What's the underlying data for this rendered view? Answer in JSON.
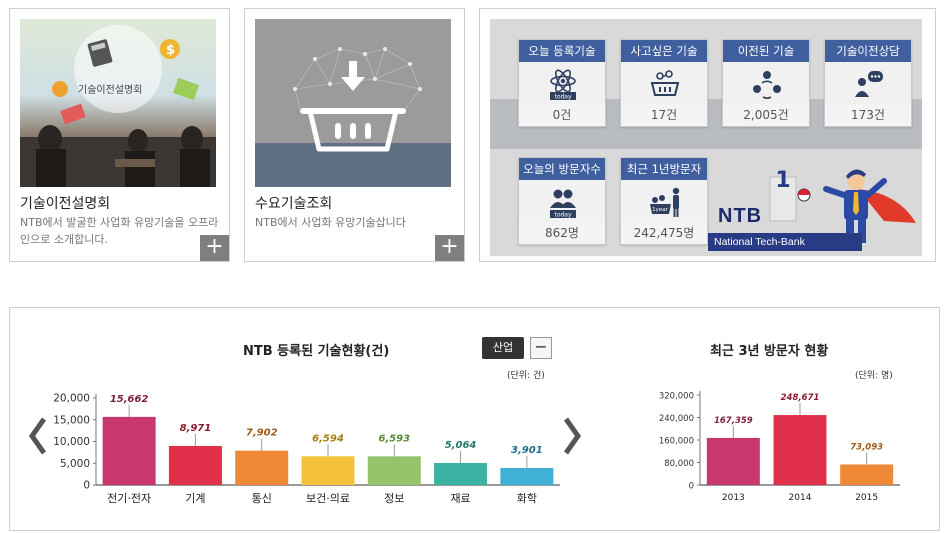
{
  "cards": [
    {
      "title": "기술이전설명회",
      "desc": "NTB에서 발굴한 사업화 유망기술을 오프라인으로 소개합니다.",
      "image_caption": "기술이전설명회",
      "more": "+"
    },
    {
      "title": "수요기술조회",
      "desc": "NTB에서 사업화 유망기술삽니다",
      "more": "+"
    }
  ],
  "stats": {
    "items": [
      {
        "label": "오늘 등록기술",
        "value": "0건",
        "icon": "atom-today-icon",
        "icon_text": "today"
      },
      {
        "label": "사고싶은 기술",
        "value": "17건",
        "icon": "cart-icon"
      },
      {
        "label": "이전된 기술",
        "value": "2,005건",
        "icon": "people-group-icon"
      },
      {
        "label": "기술이전상담",
        "value": "173건",
        "icon": "consult-icon"
      },
      {
        "label": "오늘의 방문자수",
        "value": "862명",
        "icon": "visitors-today-icon",
        "icon_text": "today"
      },
      {
        "label": "최근 1년방문자",
        "value": "242,475명",
        "icon": "year-visitors-icon",
        "icon_text": "1year"
      }
    ],
    "brand": {
      "logo": "NTB",
      "name": "National Tech-Bank"
    }
  },
  "chart1_ui": {
    "title": "NTB 등록된 기술현황(건)",
    "filter_label": "산업",
    "collapse_label": "−",
    "unit": "(단위: 건)"
  },
  "chart2_ui": {
    "title": "최근 3년 방문자 현황",
    "unit": "(단위: 명)"
  },
  "colors": {
    "header_blue": "#3f5f9e",
    "bar_magenta": "#c8386f",
    "bar_red": "#e0304a",
    "bar_orange": "#ee8a37",
    "bar_yellow": "#f3c13a",
    "bar_green": "#93c36b",
    "bar_teal": "#3ab3a2",
    "bar_cyan": "#3fb1d6"
  },
  "chart_data": [
    {
      "type": "bar",
      "title": "NTB 등록된 기술현황(건)",
      "categories": [
        "전기·전자",
        "기계",
        "통신",
        "보건·의료",
        "정보",
        "재료",
        "화학"
      ],
      "values": [
        15662,
        8971,
        7902,
        6594,
        6593,
        5064,
        3901
      ],
      "value_labels": [
        "15,662",
        "8,971",
        "7,902",
        "6,594",
        "6,593",
        "5,064",
        "3,901"
      ],
      "colors": [
        "#c8386f",
        "#e0304a",
        "#ee8a37",
        "#f3c13a",
        "#93c36b",
        "#3ab3a2",
        "#3fb1d6"
      ],
      "label_colors": [
        "#7a1f40",
        "#8a1b2c",
        "#a05a1c",
        "#a57c12",
        "#5a8a35",
        "#227a6e",
        "#1f6f8f"
      ],
      "yticks": [
        0,
        5000,
        10000,
        15000,
        20000
      ],
      "ytick_labels": [
        "0",
        "5,000",
        "10,000",
        "15,000",
        "20,000"
      ],
      "ylim": [
        0,
        20000
      ],
      "unit": "(단위: 건)"
    },
    {
      "type": "bar",
      "title": "최근 3년 방문자 현황",
      "categories": [
        "2013",
        "2014",
        "2015"
      ],
      "values": [
        167359,
        248671,
        73093
      ],
      "value_labels": [
        "167,359",
        "248,671",
        "73,093"
      ],
      "colors": [
        "#c8386f",
        "#e0304a",
        "#ee8a37"
      ],
      "label_colors": [
        "#7a1f40",
        "#8a1b2c",
        "#a05a1c"
      ],
      "yticks": [
        0,
        80000,
        160000,
        240000,
        320000
      ],
      "ytick_labels": [
        "0",
        "80,000",
        "160,000",
        "240,000",
        "320,000"
      ],
      "ylim": [
        0,
        320000
      ],
      "unit": "(단위: 명)"
    }
  ]
}
